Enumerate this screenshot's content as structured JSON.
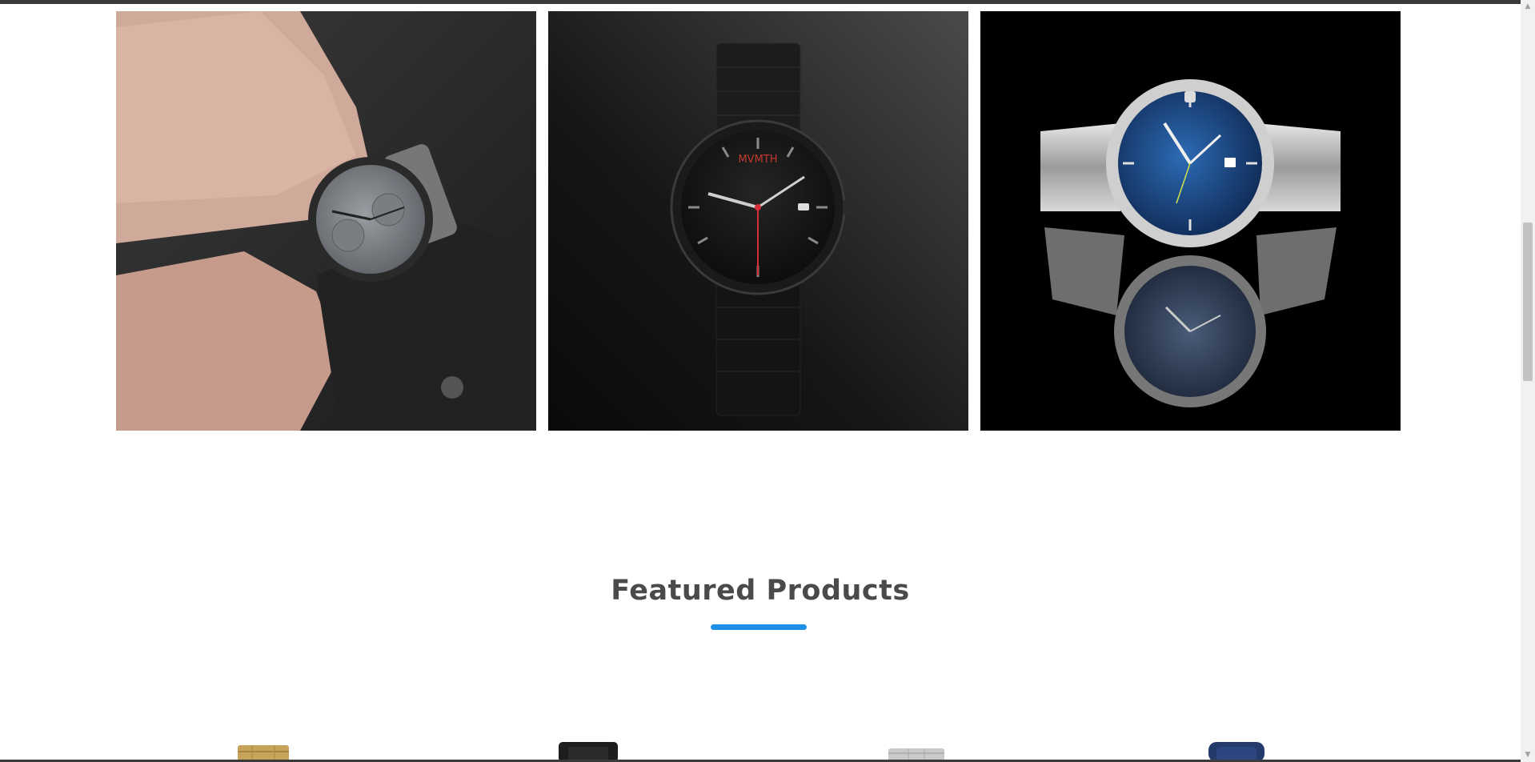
{
  "gallery": {
    "images": [
      {
        "alt": "Chronograph watch on wrist",
        "icon": "watch-on-wrist"
      },
      {
        "alt": "Black watch",
        "icon": "black-watch",
        "brand_text": "MVMTH"
      },
      {
        "alt": "Silver watch with blue dial",
        "icon": "silver-blue-watch"
      }
    ]
  },
  "featured": {
    "title": "Featured Products",
    "accent_color": "#1e90e6"
  },
  "products_peek": [
    {
      "icon": "gold-watch-strap"
    },
    {
      "icon": "black-leather-strap"
    },
    {
      "icon": "silver-steel-strap"
    },
    {
      "icon": "navy-fabric-strap"
    }
  ],
  "scrollbar": {
    "up_glyph": "▲",
    "down_glyph": "▼"
  }
}
